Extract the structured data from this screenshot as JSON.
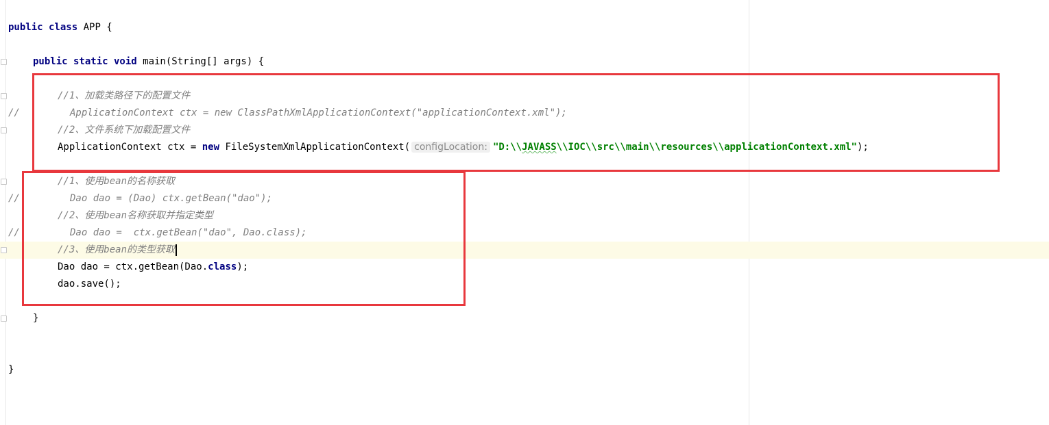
{
  "editor": {
    "lines": {
      "class_decl": {
        "kw": "public class",
        "rest": " APP {"
      },
      "main_decl": {
        "kw": "public static void",
        "rest": " main(String[] args) {"
      },
      "c1": "//1、加载类路径下的配置文件",
      "l1_prefix": "//",
      "l1": "ApplicationContext ctx = new ClassPathXmlApplicationContext(\"applicationContext.xml\");",
      "c2": "//2、文件系统下加载配置文件",
      "l2_pre": "ApplicationContext ctx = ",
      "l2_kw": "new",
      "l2_mid": " FileSystemXmlApplicationContext(",
      "l2_hint": "configLocation:",
      "l2_str_a": "\"D:\\\\",
      "l2_str_b": "JAVASS",
      "l2_str_c": "\\\\IOC\\\\src\\\\main\\\\resources\\\\applicationContext.xml\"",
      "l2_end": ");",
      "c3": "//1、使用bean的名称获取",
      "l3_prefix": "//",
      "l3": "Dao dao = (Dao) ctx.getBean(\"dao\");",
      "c4": "//2、使用bean名称获取并指定类型",
      "l4_prefix": "//",
      "l4": "Dao dao =  ctx.getBean(\"dao\", Dao.class);",
      "c5": "//3、使用bean的类型获取",
      "l5_pre": "Dao dao = ctx.getBean(Dao.",
      "l5_kw": "class",
      "l5_end": ");",
      "l6": "dao.save();",
      "close_main": "}",
      "close_class": "}"
    }
  },
  "colors": {
    "keyword": "#000080",
    "comment": "#808080",
    "string": "#008000",
    "highlight_box": "#e8383d",
    "caret_line": "#fdfbe6"
  }
}
